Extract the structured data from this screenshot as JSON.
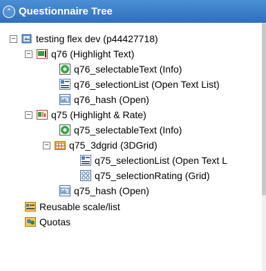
{
  "panel": {
    "title": "Questionnaire Tree"
  },
  "tree": {
    "root": {
      "label": "testing flex dev (p44427718)"
    },
    "q76": {
      "label": "q76 (Highlight Text)",
      "children": [
        "q76_selectableText (Info)",
        "q76_selectionList (Open Text List)",
        "q76_hash (Open)"
      ]
    },
    "q75": {
      "label": "q75 (Highlight & Rate)",
      "selectable": "q75_selectableText (Info)",
      "grid": {
        "label": "q75_3dgrid (3DGrid)",
        "children": [
          "q75_selectionList (Open Text L",
          "q75_selectionRating (Grid)"
        ]
      },
      "hash": "q75_hash (Open)"
    },
    "reusable": "Reusable scale/list",
    "quotas": "Quotas"
  },
  "toggle_symbol": "−",
  "colors": {
    "header": "#2f6fbe",
    "accent": "#2e8b2e"
  }
}
